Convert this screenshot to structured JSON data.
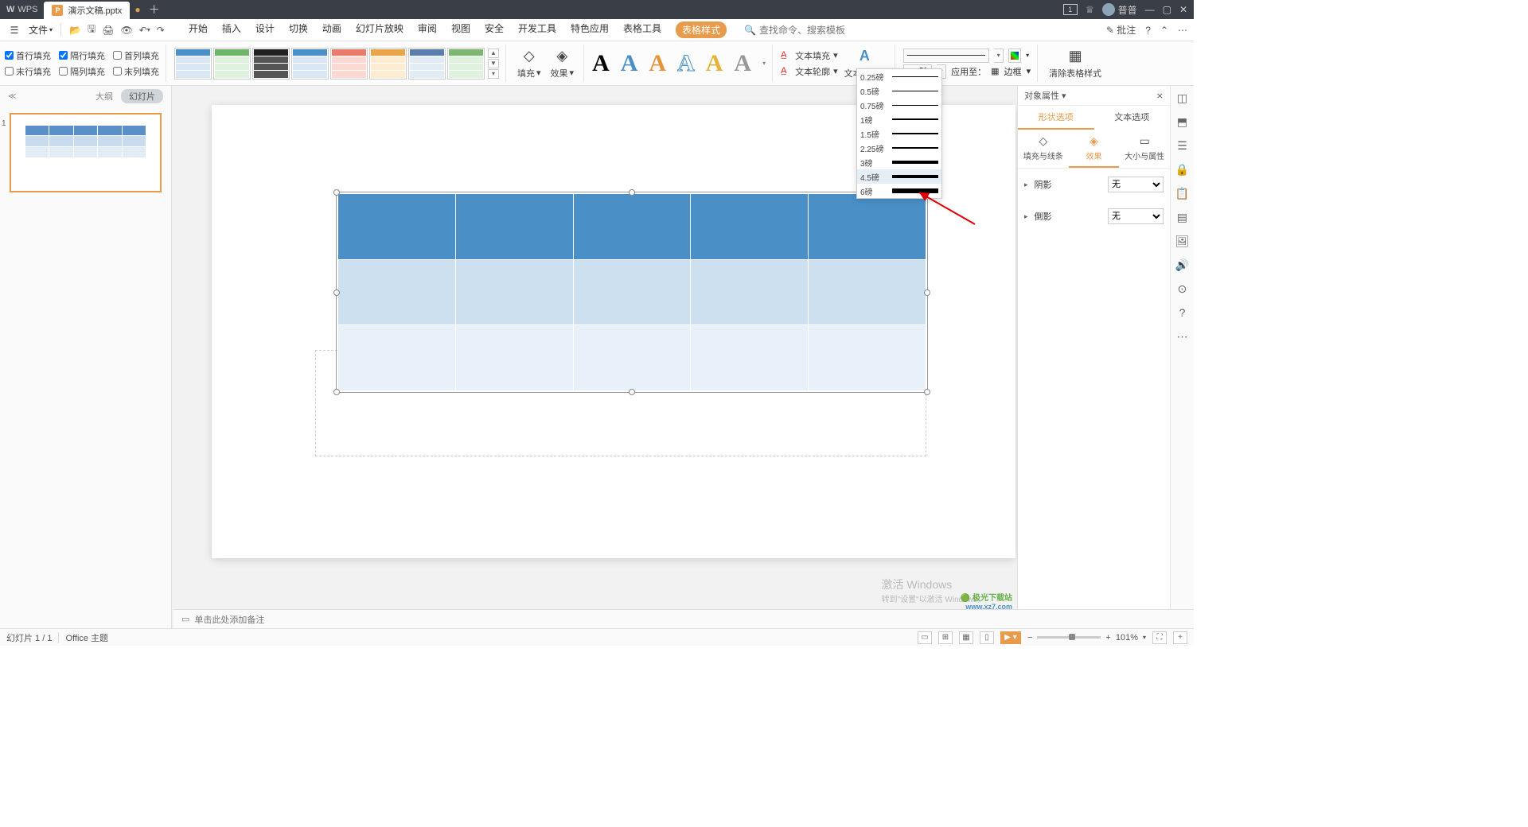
{
  "titlebar": {
    "appname": "WPS",
    "tab_title": "演示文稿.pptx",
    "user": "普普",
    "badge": "1"
  },
  "menu": {
    "file": "文件",
    "tabs": [
      "开始",
      "插入",
      "设计",
      "切换",
      "动画",
      "幻灯片放映",
      "审阅",
      "视图",
      "安全",
      "开发工具",
      "特色应用",
      "表格工具",
      "表格样式"
    ],
    "search_placeholder": "查找命令、搜索模板",
    "annotate": "批注"
  },
  "ribbon": {
    "checks": {
      "r1c1": "首行填充",
      "r1c2": "隔行填充",
      "r1c3": "首列填充",
      "r2c1": "末行填充",
      "r2c2": "隔列填充",
      "r2c3": "末列填充"
    },
    "fill": "填充",
    "effect": "效果",
    "textfill": "文本填充",
    "textoutline": "文本轮廓",
    "texteffect": "文本效果",
    "pt_value": "4.5磅",
    "apply_to": "应用至：",
    "border": "边框",
    "clearstyle": "清除表格样式",
    "colorpick": "⬚",
    "linepick": "—"
  },
  "line_weights": [
    "0.25磅",
    "0.5磅",
    "0.75磅",
    "1磅",
    "1.5磅",
    "2.25磅",
    "3磅",
    "4.5磅",
    "6磅"
  ],
  "leftpanel": {
    "outline": "大纲",
    "slides": "幻灯片",
    "slidenum": "1"
  },
  "notes_placeholder": "单击此处添加备注",
  "taskpane": {
    "title": "对象属性",
    "maintabs": [
      "形状选项",
      "文本选项"
    ],
    "subtabs": [
      "填充与线条",
      "效果",
      "大小与属性"
    ],
    "shadow": "阴影",
    "bevel": "倒影",
    "none": "无"
  },
  "status": {
    "slide": "幻灯片 1 / 1",
    "theme": "Office 主题",
    "zoom": "101%"
  },
  "watermark": {
    "title": "激活 Windows",
    "sub": "转到\"设置\"以激活 Windows。"
  },
  "brand": {
    "name": "极光下载站",
    "url": "www.xz7.com"
  }
}
